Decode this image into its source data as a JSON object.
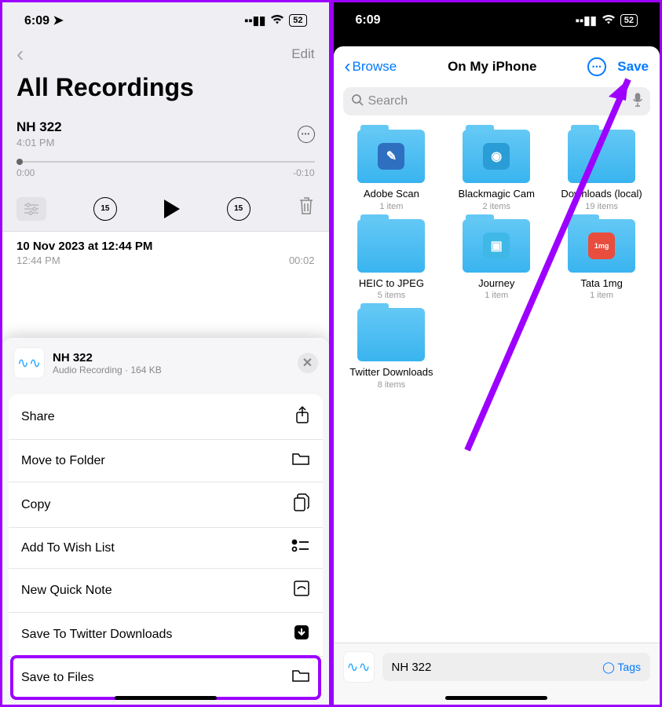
{
  "left": {
    "status": {
      "time": "6:09",
      "loc": "➤",
      "battery": "52"
    },
    "nav": {
      "edit": "Edit"
    },
    "title": "All Recordings",
    "recording": {
      "name": "NH 322",
      "time": "4:01 PM",
      "start": "0:00",
      "end": "-0:10",
      "skip": "15"
    },
    "recording2": {
      "title": "10 Nov 2023 at 12:44 PM",
      "time": "12:44 PM",
      "duration": "00:02"
    },
    "sheet": {
      "name": "NH 322",
      "sub": "Audio Recording · 164 KB",
      "items": [
        {
          "label": "Share",
          "icon": "⎋"
        },
        {
          "label": "Move to Folder",
          "icon": "▭"
        },
        {
          "label": "Copy",
          "icon": "⧉"
        },
        {
          "label": "Add To Wish List",
          "icon": "≔"
        },
        {
          "label": "New Quick Note",
          "icon": "✎"
        },
        {
          "label": "Save To Twitter Downloads",
          "icon": "⬇"
        },
        {
          "label": "Save to Files",
          "icon": "▭"
        }
      ]
    }
  },
  "right": {
    "status": {
      "time": "6:09",
      "battery": "52"
    },
    "nav": {
      "back": "Browse",
      "title": "On My iPhone",
      "save": "Save"
    },
    "search": {
      "placeholder": "Search"
    },
    "folders": [
      {
        "name": "Adobe Scan",
        "count": "1 item",
        "badge": "✎",
        "color": "#2e6fbf"
      },
      {
        "name": "Blackmagic Cam",
        "count": "2 items",
        "badge": "◉",
        "color": "#2a9cd6"
      },
      {
        "name": "Downloads (local)",
        "count": "19 items",
        "badge": "",
        "color": ""
      },
      {
        "name": "HEIC to JPEG",
        "count": "5 items",
        "badge": "",
        "color": ""
      },
      {
        "name": "Journey",
        "count": "1 item",
        "badge": "▣",
        "color": "#3fb8e8"
      },
      {
        "name": "Tata 1mg",
        "count": "1 item",
        "badge": "1mg",
        "color": "#e84d3d"
      },
      {
        "name": "Twitter Downloads",
        "count": "8 items",
        "badge": "",
        "color": ""
      }
    ],
    "filename": "NH 322",
    "tags": "Tags"
  }
}
